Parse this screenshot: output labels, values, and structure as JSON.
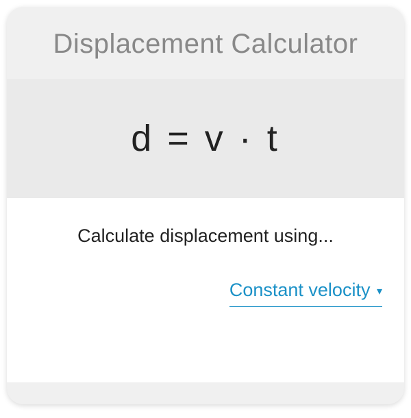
{
  "title": "Displacement Calculator",
  "formula": "d  =  v · t",
  "prompt": "Calculate displacement using...",
  "mode": {
    "selected": "Constant velocity",
    "triangle": "▾"
  }
}
